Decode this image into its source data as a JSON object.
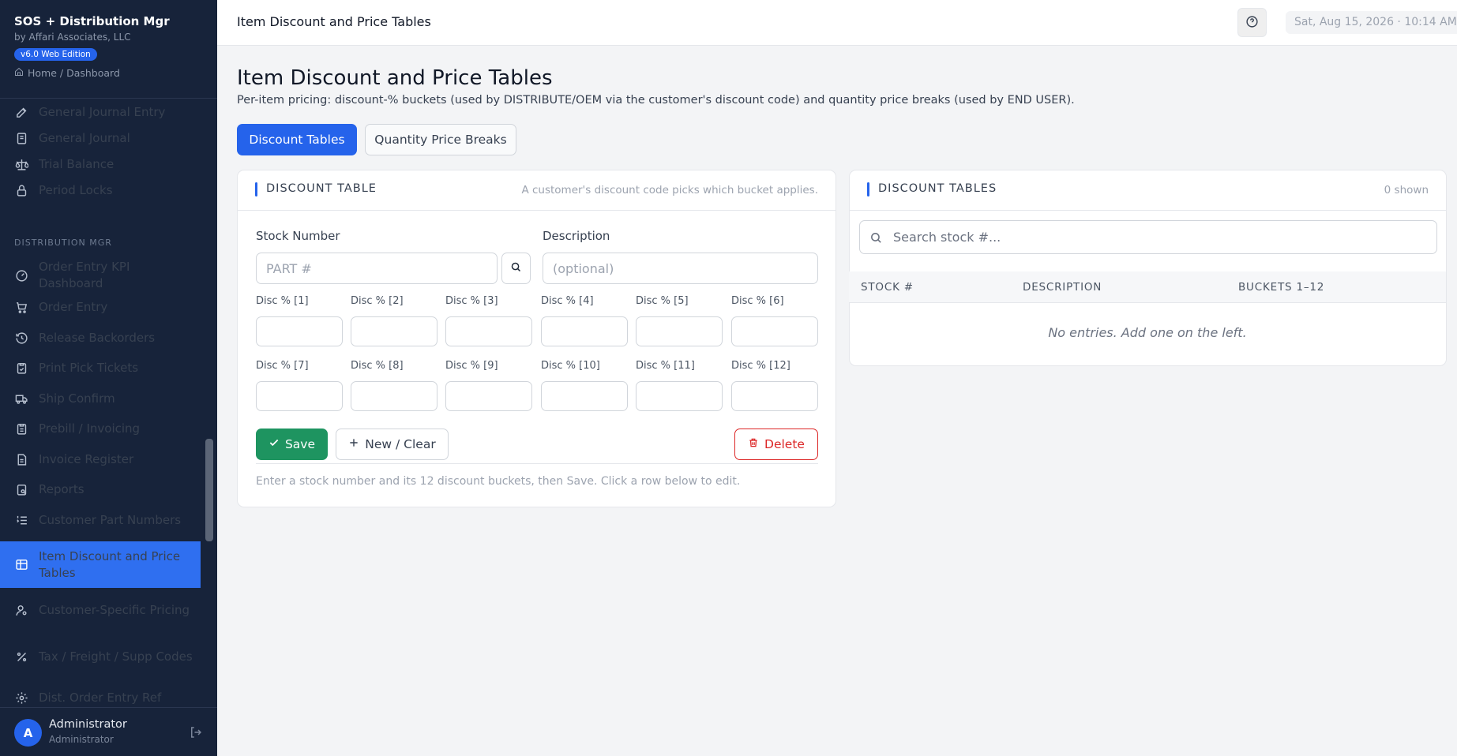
{
  "app": {
    "title": "SOS + Distribution Mgr",
    "vendor": "by Affari Associates, LLC",
    "edition": "v6.0 Web Edition",
    "breadcrumb": "Home / Dashboard"
  },
  "sidebar": {
    "items_top": [
      {
        "label": "General Journal Entry",
        "icon": "pen-icon"
      },
      {
        "label": "General Journal",
        "icon": "book-icon"
      },
      {
        "label": "Trial Balance",
        "icon": "scale-icon"
      },
      {
        "label": "Period Locks",
        "icon": "lock-icon"
      }
    ],
    "section_label": "DISTRIBUTION MGR",
    "items": [
      {
        "label": "Order Entry KPI Dashboard",
        "icon": "gauge-icon"
      },
      {
        "label": "Order Entry",
        "icon": "cart-icon"
      },
      {
        "label": "Release Backorders",
        "icon": "history-icon"
      },
      {
        "label": "Print Pick Tickets",
        "icon": "clipboard-check-icon"
      },
      {
        "label": "Ship Confirm",
        "icon": "truck-icon"
      },
      {
        "label": "Prebill / Invoicing",
        "icon": "clipboard-list-icon"
      },
      {
        "label": "Invoice Register",
        "icon": "file-text-icon"
      },
      {
        "label": "Reports",
        "icon": "report-icon"
      },
      {
        "label": "Customer Part Numbers",
        "icon": "list-ordered-icon"
      },
      {
        "label": "Item Discount and Price Tables",
        "icon": "table-icon",
        "active": true
      },
      {
        "label": "Customer-Specific Pricing",
        "icon": "user-cog-icon"
      },
      {
        "label": "Tax / Freight / Supp Codes",
        "icon": "percent-icon"
      },
      {
        "label": "Dist. Order Entry Ref",
        "icon": "gear-icon"
      }
    ]
  },
  "user": {
    "initial": "A",
    "name": "Administrator",
    "role": "Administrator"
  },
  "topbar": {
    "title": "Item Discount and Price Tables",
    "datetime": "Sat, Aug 15, 2026 · 10:14 AM"
  },
  "page": {
    "title": "Item Discount and Price Tables",
    "description": "Per-item pricing: discount-% buckets (used by DISTRIBUTE/OEM via the customer's discount code) and quantity price breaks (used by END USER).",
    "tabs": [
      "Discount Tables",
      "Quantity Price Breaks"
    ]
  },
  "form": {
    "title": "DISCOUNT TABLE",
    "hint": "A customer's discount code picks which bucket applies.",
    "stock_label": "Stock Number",
    "stock_placeholder": "PART #",
    "desc_label": "Description",
    "desc_placeholder": "(optional)",
    "disc_labels": [
      "Disc % [1]",
      "Disc % [2]",
      "Disc % [3]",
      "Disc % [4]",
      "Disc % [5]",
      "Disc % [6]",
      "Disc % [7]",
      "Disc % [8]",
      "Disc % [9]",
      "Disc % [10]",
      "Disc % [11]",
      "Disc % [12]"
    ],
    "save": "Save",
    "new_clear": "New / Clear",
    "delete": "Delete",
    "footnote": "Enter a stock number and its 12 discount buckets, then Save. Click a row below to edit."
  },
  "list": {
    "title": "DISCOUNT TABLES",
    "count": "0 shown",
    "search_placeholder": "Search stock #...",
    "columns": [
      "STOCK #",
      "DESCRIPTION",
      "BUCKETS 1–12"
    ],
    "empty": "No entries. Add one on the left."
  },
  "colors": {
    "accent": "#2563eb",
    "sidebar_bg": "#17233a",
    "save_green": "#1e9460",
    "delete_red": "#dc2626"
  }
}
